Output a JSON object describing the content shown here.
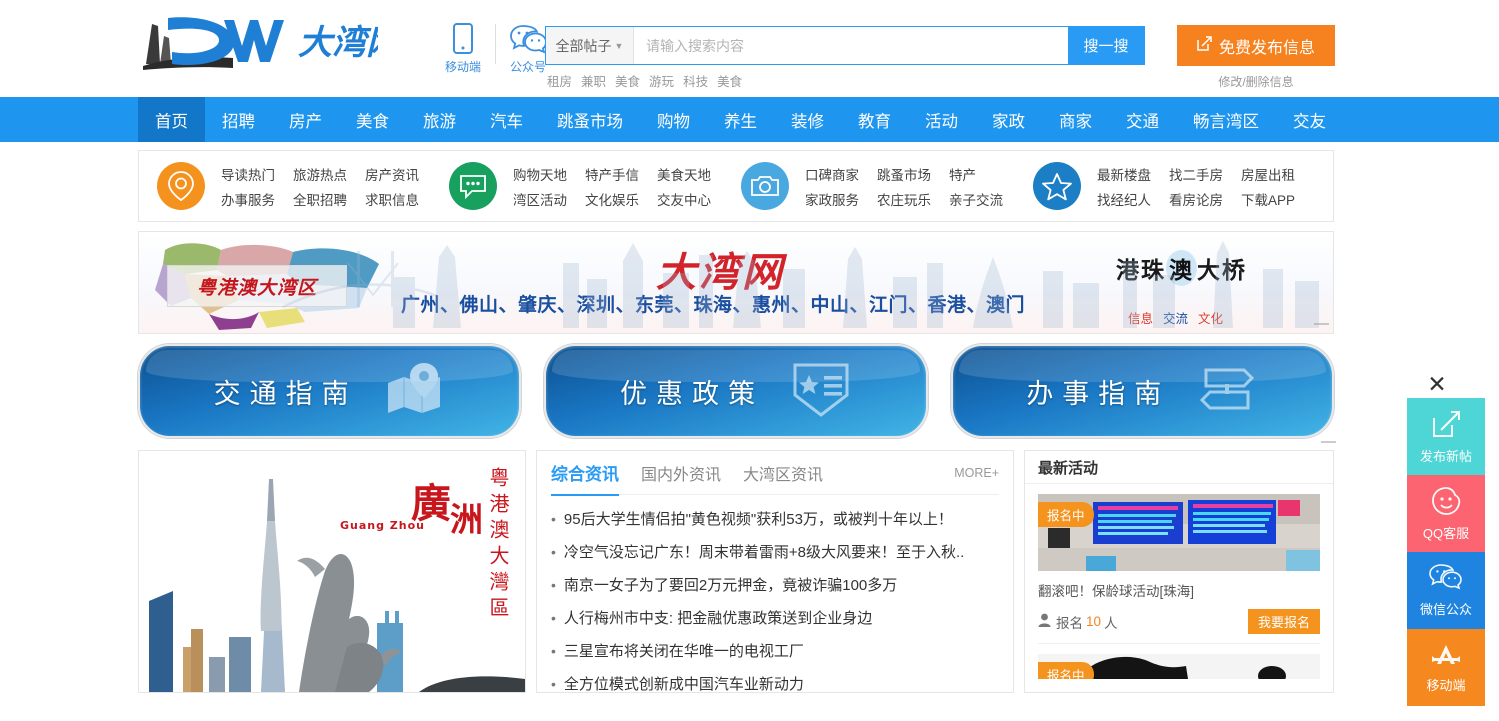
{
  "header": {
    "logo_text": "大湾网",
    "logo_mark": "DW",
    "qr_items": [
      {
        "label": "移动端",
        "icon": "mobile-icon"
      },
      {
        "label": "公众号",
        "icon": "wechat-icon"
      }
    ],
    "search": {
      "category": "全部帖子",
      "placeholder": "请输入搜索内容",
      "button": "搜一搜",
      "hot_keywords": [
        "租房",
        "兼职",
        "美食",
        "游玩",
        "科技",
        "美食"
      ]
    },
    "publish": {
      "button": "免费发布信息",
      "sub_link": "修改/删除信息",
      "color": "#f5821f"
    }
  },
  "nav": {
    "active_index": 0,
    "items": [
      "首页",
      "招聘",
      "房产",
      "美食",
      "旅游",
      "汽车",
      "跳蚤市场",
      "购物",
      "养生",
      "装修",
      "教育",
      "活动",
      "家政",
      "商家",
      "交通",
      "畅言湾区",
      "交友"
    ],
    "bg_color": "#1e95ef",
    "active_bg": "#1277c8"
  },
  "quick_links": [
    {
      "icon": "location-pin-icon",
      "color": "#f5921e",
      "links": [
        "导读热门",
        "旅游热点",
        "房产资讯",
        "办事服务",
        "全职招聘",
        "求职信息"
      ]
    },
    {
      "icon": "chat-bubble-icon",
      "color": "#17a05e",
      "links": [
        "购物天地",
        "特产手信",
        "美食天地",
        "湾区活动",
        "文化娱乐",
        "交友中心"
      ]
    },
    {
      "icon": "camera-icon",
      "color": "#4aa8e0",
      "links": [
        "口碑商家",
        "跳蚤市场",
        "特产",
        "家政服务",
        "农庄玩乐",
        "亲子交流"
      ]
    },
    {
      "icon": "star-icon",
      "color": "#1c7ec4",
      "links": [
        "最新楼盘",
        "找二手房",
        "房屋出租",
        "找经纪人",
        "看房论房",
        "下载APP"
      ]
    }
  ],
  "banner": {
    "plaque_text": "粤港澳大湾区",
    "cities": "广州、佛山、肇庆、深圳、东莞、珠海、惠州、中山、江门、香港、澳门",
    "brand": "大湾网",
    "bridge_title_1": "港珠",
    "bridge_title_ao": "澳",
    "bridge_title_2": "大桥",
    "tags": [
      "信息",
      "交流",
      "文化"
    ],
    "minimize": "—"
  },
  "feature_buttons": [
    {
      "label": "交通指南",
      "icon": "map-pin-icon"
    },
    {
      "label": "优惠政策",
      "icon": "badge-star-icon"
    },
    {
      "label": "办事指南",
      "icon": "signpost-icon"
    }
  ],
  "feature_minimize": "—",
  "hero_image": {
    "city_cn": "廣",
    "city_cn2": "洲",
    "pinyin": "Guang Zhou",
    "vertical_text": "粤港澳大灣區"
  },
  "news": {
    "tabs": [
      "综合资讯",
      "国内外资讯",
      "大湾区资讯"
    ],
    "active_tab": 0,
    "more_label": "MORE+",
    "items": [
      "95后大学生情侣拍\"黄色视频\"获利53万，或被判十年以上！",
      "冷空气没忘记广东！周末带着雷雨+8级大风要来！至于入秋..",
      "南京一女子为了要回2万元押金，竟被诈骗100多万",
      "人行梅州市中支: 把金融优惠政策送到企业身边",
      "三星宣布将关闭在华唯一的电视工厂",
      "全方位模式创新成中国汽车业新动力"
    ]
  },
  "activities": {
    "title": "最新活动",
    "cards": [
      {
        "badge": "报名中",
        "title": "翻滚吧！保龄球活动[珠海]",
        "meta_label": "报名",
        "count": "10",
        "unit": "人",
        "join_label": "我要报名"
      },
      {
        "badge": "报名中",
        "title": "",
        "meta_label": "",
        "count": "",
        "unit": "",
        "join_label": ""
      }
    ]
  },
  "float_bar": {
    "close": "✕",
    "items": [
      {
        "label": "发布新帖",
        "icon": "compose-icon",
        "color": "#4ed5d5"
      },
      {
        "label": "QQ客服",
        "icon": "smiley-icon",
        "color": "#fb6470"
      },
      {
        "label": "微信公众",
        "icon": "wechat-icon",
        "color": "#1e84e0"
      },
      {
        "label": "移动端",
        "icon": "app-store-icon",
        "color": "#f5881f"
      }
    ]
  }
}
